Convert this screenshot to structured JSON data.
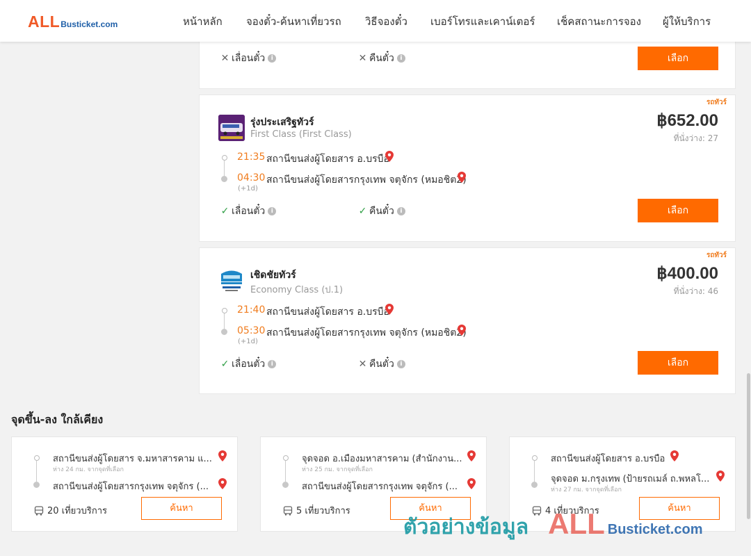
{
  "header": {
    "logo_big": "ALL",
    "logo_small": "Busticket.com",
    "nav": [
      "หน้าหลัก",
      "จองตั๋ว-ค้นหาเที่ยวรถ",
      "วิธีจองตั๋ว",
      "เบอร์โทรและเคาน์เตอร์",
      "เช็คสถานะการจอง",
      "ผู้ให้บริการ"
    ]
  },
  "top_card": {
    "reschedule": "เลื่อนตั๋ว",
    "refund": "คืนตั๋ว",
    "select": "เลือก"
  },
  "trips": [
    {
      "tag": "รถทัวร์",
      "operator": "รุ่งประเสริฐทัวร์",
      "class": "First Class (First Class)",
      "price": "฿652.00",
      "seats": "ที่นั่งว่าง: 27",
      "dep_time": "21:35",
      "dep_station": "สถานีขนส่งผู้โดยสาร อ.บรบือ",
      "arr_time": "04:30",
      "arr_station": "สถานีขนส่งผู้โดยสารกรุงเทพ จตุจักร (หมอชิต2)",
      "next_day": "(+1d)",
      "reschedule": "เลื่อนตั๋ว",
      "reschedule_ok": true,
      "refund": "คืนตั๋ว",
      "refund_ok": true,
      "select": "เลือก"
    },
    {
      "tag": "รถทัวร์",
      "operator": "เชิดชัยทัวร์",
      "class": "Economy Class (ป.1)",
      "price": "฿400.00",
      "seats": "ที่นั่งว่าง: 46",
      "dep_time": "21:40",
      "dep_station": "สถานีขนส่งผู้โดยสาร อ.บรบือ",
      "arr_time": "05:30",
      "arr_station": "สถานีขนส่งผู้โดยสารกรุงเทพ จตุจักร (หมอชิต2)",
      "next_day": "(+1d)",
      "reschedule": "เลื่อนตั๋ว",
      "reschedule_ok": true,
      "refund": "คืนตั๋ว",
      "refund_ok": false,
      "select": "เลือก"
    }
  ],
  "nearby": {
    "title": "จุดขึ้น-ลง ใกล้เคียง",
    "items": [
      {
        "from": "สถานีขนส่งผู้โดยสาร จ.มหาสารคาม แ...",
        "from_dist": "ห่าง 24 กม. จากจุดที่เลือก",
        "to": "สถานีขนส่งผู้โดยสารกรุงเทพ จตุจักร (...",
        "to_dist": "",
        "trips": "20 เที่ยวบริการ",
        "search": "ค้นหา"
      },
      {
        "from": "จุดจอด อ.เมืองมหาสารคาม (สำนักงาน...",
        "from_dist": "ห่าง 25 กม. จากจุดที่เลือก",
        "to": "สถานีขนส่งผู้โดยสารกรุงเทพ จตุจักร (...",
        "to_dist": "",
        "trips": "5 เที่ยวบริการ",
        "search": "ค้นหา"
      },
      {
        "from": "สถานีขนส่งผู้โดยสาร อ.บรบือ",
        "from_dist": "",
        "to": "จุดจอด ม.กรุงเทพ (ป้ายรถเมล์ ถ.พหลโ...",
        "to_dist": "ห่าง 27 กม. จากจุดที่เลือก",
        "trips": "4 เที่ยวบริการ",
        "search": "ค้นหา"
      }
    ]
  },
  "watermark": {
    "thai": "ตัวอย่างข้อมูล",
    "big": "ALL",
    "small": "Busticket.com"
  },
  "colors": {
    "accent": "#ff6a00",
    "time": "#f07c1e",
    "ok": "#2e9e44"
  }
}
